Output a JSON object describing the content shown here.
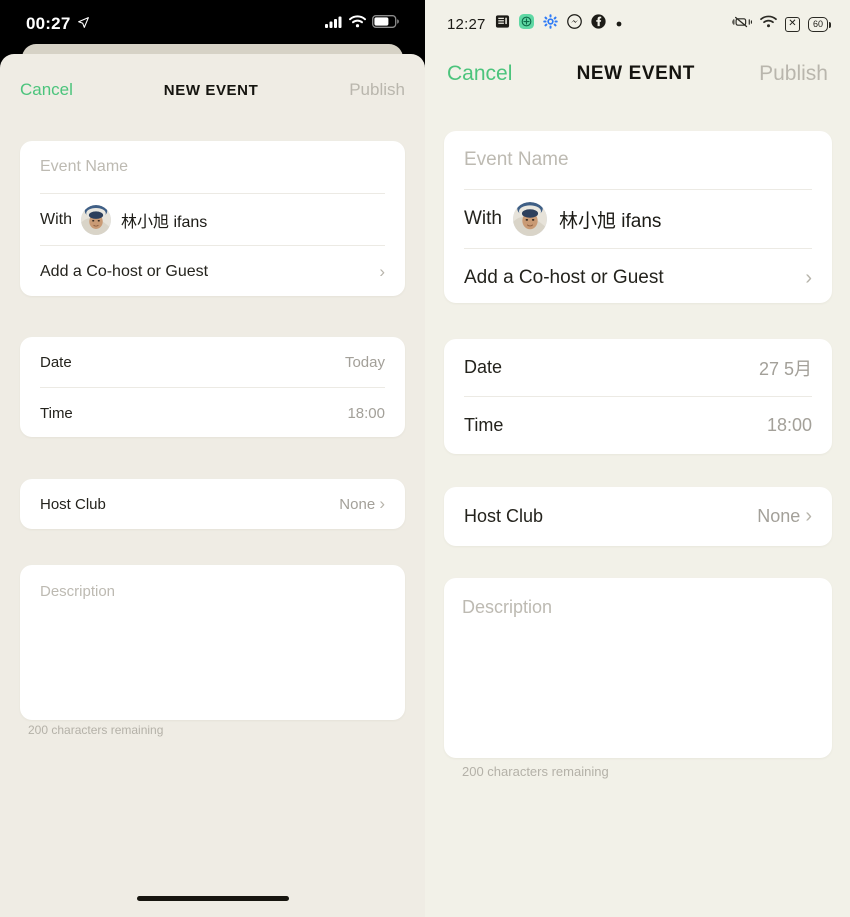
{
  "left_panel": {
    "platform": "ios",
    "status_bar": {
      "time": "00:27",
      "location_icon": "location-arrow-icon",
      "cellular_icon": "cellular-bars-icon",
      "wifi_icon": "wifi-icon",
      "battery_icon": "battery-icon"
    },
    "navbar": {
      "cancel": "Cancel",
      "title": "NEW EVENT",
      "publish": "Publish"
    },
    "event_card": {
      "name_placeholder": "Event Name",
      "with_label": "With",
      "host_name": "林小旭 ifans",
      "avatar": "user-avatar",
      "add_guest_label": "Add a Co-host or Guest",
      "chevron": "›"
    },
    "datetime_card": {
      "date_label": "Date",
      "date_value": "Today",
      "time_label": "Time",
      "time_value": "18:00"
    },
    "club_card": {
      "label": "Host Club",
      "value": "None",
      "chevron": "›"
    },
    "description_card": {
      "placeholder": "Description",
      "char_note": "200 characters remaining"
    }
  },
  "right_panel": {
    "platform": "android",
    "status_bar": {
      "time": "12:27",
      "notification_icons": [
        "news-app-icon",
        "green-circle-app-icon",
        "settings-gear-icon",
        "messenger-icon",
        "facebook-icon",
        "more-dot-icon"
      ],
      "vibrate_icon": "vibrate-icon",
      "wifi_icon": "wifi-icon",
      "no-sim_icon": "boxed-x-icon",
      "battery_level": "60"
    },
    "navbar": {
      "cancel": "Cancel",
      "title": "NEW EVENT",
      "publish": "Publish"
    },
    "event_card": {
      "name_placeholder": "Event Name",
      "with_label": "With",
      "host_name": "林小旭 ifans",
      "avatar": "user-avatar",
      "add_guest_label": "Add a Co-host or Guest",
      "chevron": "›"
    },
    "datetime_card": {
      "date_label": "Date",
      "date_value": "27 5月",
      "time_label": "Time",
      "time_value": "18:00"
    },
    "club_card": {
      "label": "Host Club",
      "value": "None",
      "chevron": "›"
    },
    "description_card": {
      "placeholder": "Description",
      "char_note": "200 characters remaining"
    }
  },
  "colors": {
    "accent_green": "#4cc47c",
    "ios_background": "#efece4",
    "android_background": "#f2f1e8",
    "card_white": "#ffffff",
    "muted_text": "#a3a099",
    "placeholder_text": "#bdbab2",
    "primary_text": "#24231d"
  }
}
